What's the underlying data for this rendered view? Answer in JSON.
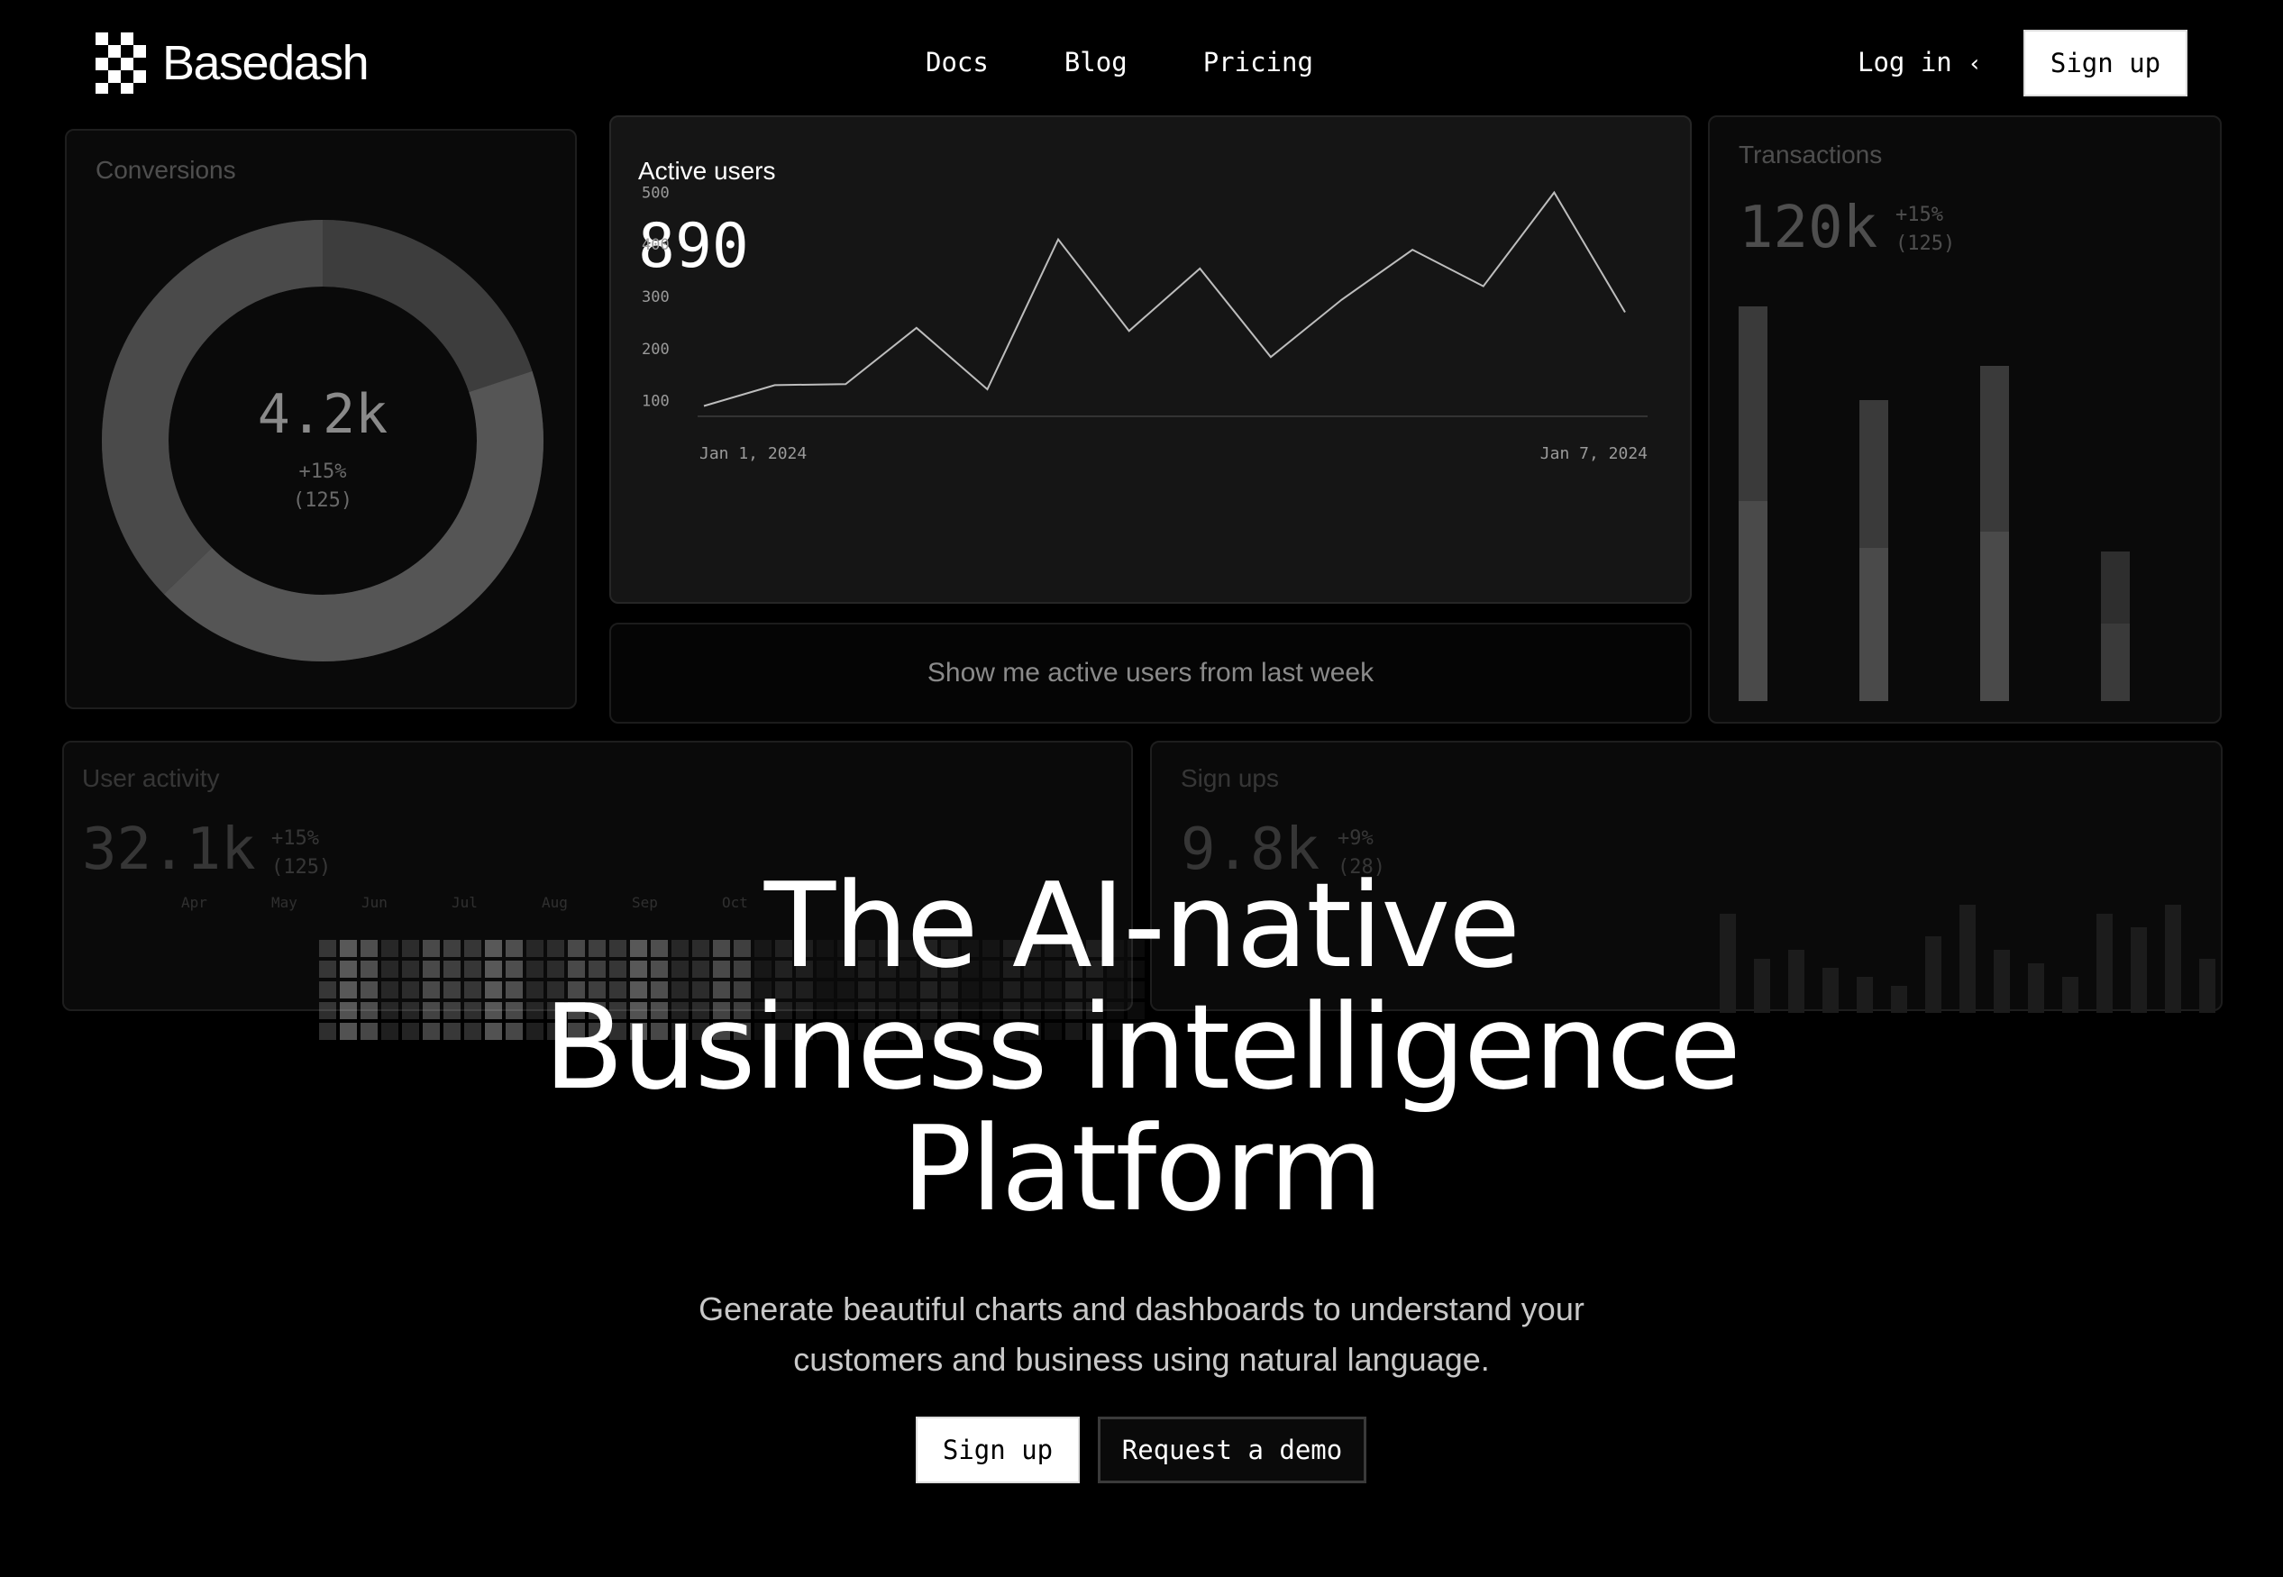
{
  "nav": {
    "brand": "Basedash",
    "links": [
      "Docs",
      "Blog",
      "Pricing"
    ],
    "login": "Log in",
    "signup": "Sign up"
  },
  "cards": {
    "conversions": {
      "title": "Conversions",
      "value": "4.2k",
      "change": "+15%",
      "count": "(125)"
    },
    "active_users": {
      "title": "Active users",
      "value": "890"
    },
    "prompt": "Show me active users from last week",
    "transactions": {
      "title": "Transactions",
      "value": "120k",
      "change": "+15%",
      "count": "(125)"
    },
    "user_activity": {
      "title": "User activity",
      "value": "32.1k",
      "change": "+15%",
      "count": "(125)",
      "months": [
        "Apr",
        "May",
        "Jun",
        "Jul",
        "Aug",
        "Sep",
        "Oct"
      ]
    },
    "sign_ups": {
      "title": "Sign ups",
      "value": "9.8k",
      "change": "+9%",
      "count": "(28)"
    }
  },
  "hero": {
    "line1": "The AI-native",
    "line2": "Business intelligence",
    "line3": "Platform",
    "subtitle_1": "Generate beautiful charts and dashboards to understand your",
    "subtitle_2": "customers and business using natural language.",
    "signup": "Sign up",
    "demo": "Request a demo"
  },
  "colors": {
    "background": "#000000",
    "card": "#151515",
    "text": "#ffffff"
  },
  "chart_data": {
    "type": "line",
    "title": "Active users",
    "x_labels": [
      "Jan 1, 2024",
      "Jan 7, 2024"
    ],
    "yticks": [
      100,
      200,
      300,
      400,
      500
    ],
    "ylim": [
      75,
      525
    ],
    "values": [
      88,
      128,
      130,
      238,
      120,
      408,
      232,
      352,
      182,
      292,
      388,
      318,
      498,
      268
    ],
    "grid": false
  }
}
